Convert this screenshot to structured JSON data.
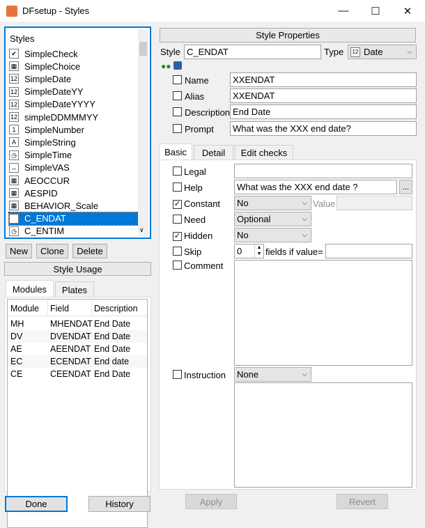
{
  "window": {
    "title": "DFsetup - Styles",
    "minimize": "—",
    "maximize": "☐",
    "close": "✕"
  },
  "styles": {
    "header": "Styles",
    "items": [
      {
        "label": "SimpleCheck",
        "icon": "check-icon"
      },
      {
        "label": "SimpleChoice",
        "icon": "grid-icon"
      },
      {
        "label": "SimpleDate",
        "icon": "calendar-icon"
      },
      {
        "label": "SimpleDateYY",
        "icon": "calendar-icon"
      },
      {
        "label": "SimpleDateYYYY",
        "icon": "calendar-icon"
      },
      {
        "label": "simpleDDMMMYY",
        "icon": "calendar-icon"
      },
      {
        "label": "SimpleNumber",
        "icon": "number-icon"
      },
      {
        "label": "SimpleString",
        "icon": "text-icon"
      },
      {
        "label": "SimpleTime",
        "icon": "clock-icon"
      },
      {
        "label": "SimpleVAS",
        "icon": "slider-icon"
      },
      {
        "label": "AEOCCUR",
        "icon": "grid-icon"
      },
      {
        "label": "AESPID",
        "icon": "grid-icon"
      },
      {
        "label": "BEHAVIOR_Scale",
        "icon": "grid-icon"
      },
      {
        "label": "C_ENDAT",
        "icon": "calendar-icon",
        "selected": true
      },
      {
        "label": "C_ENTIM",
        "icon": "clock-icon"
      }
    ],
    "new_label": "New",
    "clone_label": "Clone",
    "delete_label": "Delete",
    "usage_label": "Style Usage"
  },
  "usage": {
    "tabs": [
      "Modules",
      "Plates"
    ],
    "columns": [
      "Module",
      "Field",
      "Description"
    ],
    "rows": [
      [
        "MH",
        "MHENDAT",
        "End Date"
      ],
      [
        "DV",
        "DVENDAT",
        "End Date"
      ],
      [
        "AE",
        "AEENDAT",
        "End Date"
      ],
      [
        "EC",
        "ECENDAT",
        "End date"
      ],
      [
        "CE",
        "CEENDAT",
        "End Date"
      ]
    ]
  },
  "bottom": {
    "done_label": "Done",
    "history_label": "History",
    "apply_label": "Apply",
    "revert_label": "Revert"
  },
  "props": {
    "header": "Style Properties",
    "style_label": "Style",
    "style_value": "C_ENDAT",
    "type_label": "Type",
    "type_value": "Date",
    "name_label": "Name",
    "name_value": "XXENDAT",
    "alias_label": "Alias",
    "alias_value": "XXENDAT",
    "description_label": "Description",
    "description_value": "End Date",
    "prompt_label": "Prompt",
    "prompt_value": "What was the XXX end date?"
  },
  "tabs": [
    "Basic",
    "Detail",
    "Edit checks"
  ],
  "basic": {
    "legal_label": "Legal",
    "legal_value": "",
    "help_label": "Help",
    "help_value": "What was the XXX end date ?",
    "browse": "...",
    "constant_label": "Constant",
    "constant_value": "No",
    "value_label": "Value",
    "value_value": "",
    "need_label": "Need",
    "need_value": "Optional",
    "hidden_label": "Hidden",
    "hidden_value": "No",
    "skip_label": "Skip",
    "skip_value": "0",
    "skip_suffix": "fields if value=",
    "comment_label": "Comment",
    "instruction_label": "Instruction",
    "instruction_value": "None"
  }
}
